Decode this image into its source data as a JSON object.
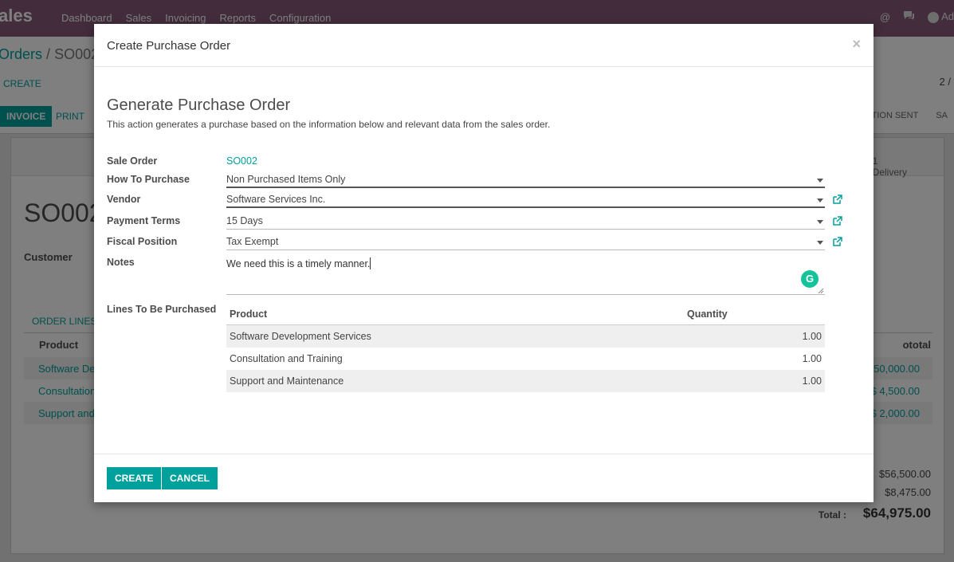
{
  "topbar": {
    "brand": "ales",
    "menu": [
      "Dashboard",
      "Sales",
      "Invoicing",
      "Reports",
      "Configuration"
    ],
    "user": "Ad"
  },
  "control_panel": {
    "breadcrumb_parent": "Orders",
    "breadcrumb_sep": "/",
    "breadcrumb_current": "SO002",
    "create_label": "CREATE",
    "pager": "2 /"
  },
  "statusbar": {
    "invoice_label": "INVOICE",
    "print_label": "PRINT",
    "stages": [
      "TION SENT",
      "SA"
    ]
  },
  "sheet": {
    "delivery_label": "Delivery",
    "delivery_count": "1",
    "title": "SO002",
    "customer_label": "Customer",
    "tab_label": "ORDER LINES",
    "col_product": "Product",
    "col_subtotal": "ototal",
    "lines": [
      {
        "product": "Software De",
        "amount": "$ 50,000.00"
      },
      {
        "product": "Consultation",
        "amount": "$ 4,500.00"
      },
      {
        "product": "Support and",
        "amount": "$ 2,000.00"
      }
    ],
    "untaxed": "$56,500.00",
    "taxes": "$8,475.00",
    "total_label": "Total :",
    "total": "$64,975.00"
  },
  "modal": {
    "title": "Create Purchase Order",
    "close": "×",
    "heading": "Generate Purchase Order",
    "description": "This action generates a purchase based on the information below and relevant data from the sales order.",
    "fields": {
      "sale_order_label": "Sale Order",
      "sale_order_value": "SO002",
      "how_label": "How To Purchase",
      "how_value": "Non Purchased Items Only",
      "vendor_label": "Vendor",
      "vendor_value": "Software Services Inc.",
      "terms_label": "Payment Terms",
      "terms_value": "15 Days",
      "fiscal_label": "Fiscal Position",
      "fiscal_value": "Tax Exempt",
      "notes_label": "Notes",
      "notes_value": "We need this is a timely manner.",
      "lines_label": "Lines To Be Purchased"
    },
    "lines_table": {
      "col_product": "Product",
      "col_quantity": "Quantity",
      "rows": [
        {
          "product": "Software Development Services",
          "quantity": "1.00"
        },
        {
          "product": "Consultation and Training",
          "quantity": "1.00"
        },
        {
          "product": "Support and Maintenance",
          "quantity": "1.00"
        }
      ]
    },
    "grammarly_glyph": "G",
    "create_button": "CREATE",
    "cancel_button": "CANCEL"
  },
  "colors": {
    "accent": "#00a09d",
    "topbar": "#875a7b"
  }
}
